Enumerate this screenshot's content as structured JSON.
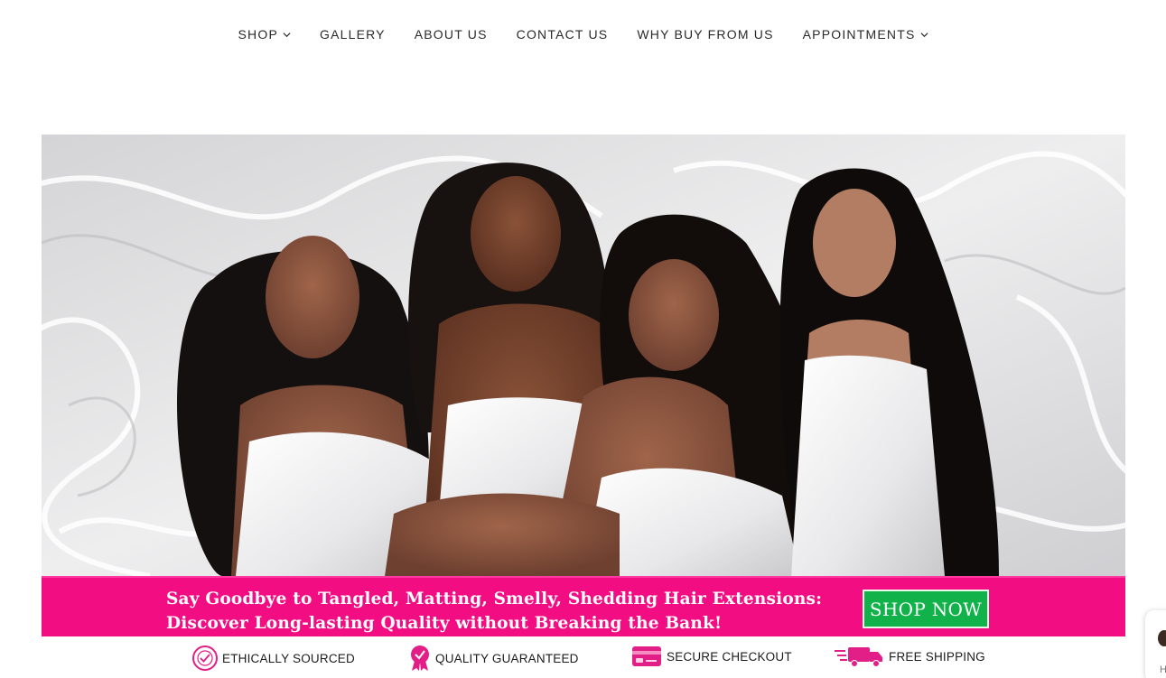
{
  "nav": {
    "items": [
      {
        "label": "SHOP",
        "has_dropdown": true
      },
      {
        "label": "GALLERY",
        "has_dropdown": false
      },
      {
        "label": "ABOUT US",
        "has_dropdown": false
      },
      {
        "label": "CONTACT US",
        "has_dropdown": false
      },
      {
        "label": "WHY BUY FROM US",
        "has_dropdown": false
      },
      {
        "label": "APPOINTMENTS",
        "has_dropdown": true
      }
    ]
  },
  "promo": {
    "line1": "Say Goodbye to Tangled, Matting, Smelly, Shedding Hair Extensions:",
    "line2": "Discover Long-lasting Quality without Breaking the Bank!",
    "button_label": "SHOP NOW",
    "bg_color": "#f20d82",
    "button_color": "#11b24a"
  },
  "features": [
    {
      "label": "ETHICALLY SOURCED",
      "icon": "ethically-sourced-stamp-icon"
    },
    {
      "label": "QUALITY GUARANTEED",
      "icon": "award-ribbon-icon"
    },
    {
      "label": "SECURE CHECKOUT",
      "icon": "credit-card-icon"
    },
    {
      "label": "FREE SHIPPING",
      "icon": "delivery-truck-icon"
    }
  ],
  "edge_widget": {
    "letter": "H"
  },
  "colors": {
    "accent_pink": "#f20d82",
    "nav_text": "#2a2a2a"
  }
}
